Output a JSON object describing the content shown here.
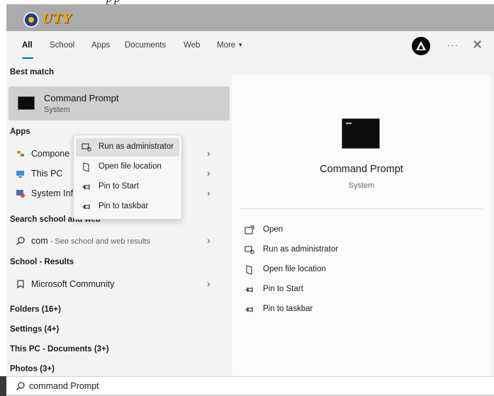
{
  "document": {
    "caption": "p p"
  },
  "logo": {
    "text": "UTY"
  },
  "tabs": [
    {
      "label": "All",
      "active": true
    },
    {
      "label": "School"
    },
    {
      "label": "Apps"
    },
    {
      "label": "Documents"
    },
    {
      "label": "Web"
    },
    {
      "label": "More"
    }
  ],
  "window_controls": {
    "more": "···",
    "close": "✕"
  },
  "best_match": {
    "header": "Best match",
    "title": "Command Prompt",
    "subtitle": "System"
  },
  "context_menu": [
    {
      "label": "Run as administrator",
      "icon": "run-as-admin-icon",
      "hover": true
    },
    {
      "label": "Open file location",
      "icon": "folder-icon"
    },
    {
      "label": "Pin to Start",
      "icon": "pin-icon"
    },
    {
      "label": "Pin to taskbar",
      "icon": "pin-icon"
    }
  ],
  "apps": {
    "header": "Apps",
    "items": [
      {
        "label": "Compone",
        "icon": "component-services-icon"
      },
      {
        "label": "This PC",
        "icon": "this-pc-icon"
      },
      {
        "label": "System Information",
        "icon": "system-info-icon"
      }
    ]
  },
  "search_web": {
    "header": "Search school and web",
    "query": "com",
    "hint": " - See school and web results"
  },
  "school_results": {
    "header": "School - Results",
    "item": "Microsoft Community"
  },
  "other_sections": {
    "folders": "Folders (16+)",
    "settings": "Settings (4+)",
    "documents": "This PC - Documents (3+)",
    "photos": "Photos (3+)"
  },
  "preview": {
    "title": "Command Prompt",
    "subtitle": "System",
    "actions": [
      {
        "label": "Open",
        "icon": "open-icon"
      },
      {
        "label": "Run as administrator",
        "icon": "run-as-admin-icon"
      },
      {
        "label": "Open file location",
        "icon": "folder-icon"
      },
      {
        "label": "Pin to Start",
        "icon": "pin-icon"
      },
      {
        "label": "Pin to taskbar",
        "icon": "pin-icon"
      }
    ]
  },
  "search": {
    "value": "command Prompt"
  },
  "colors": {
    "accent": "#0067c0",
    "selected_row": "#cfcfcf",
    "pane_bg": "#f3f3f3"
  }
}
